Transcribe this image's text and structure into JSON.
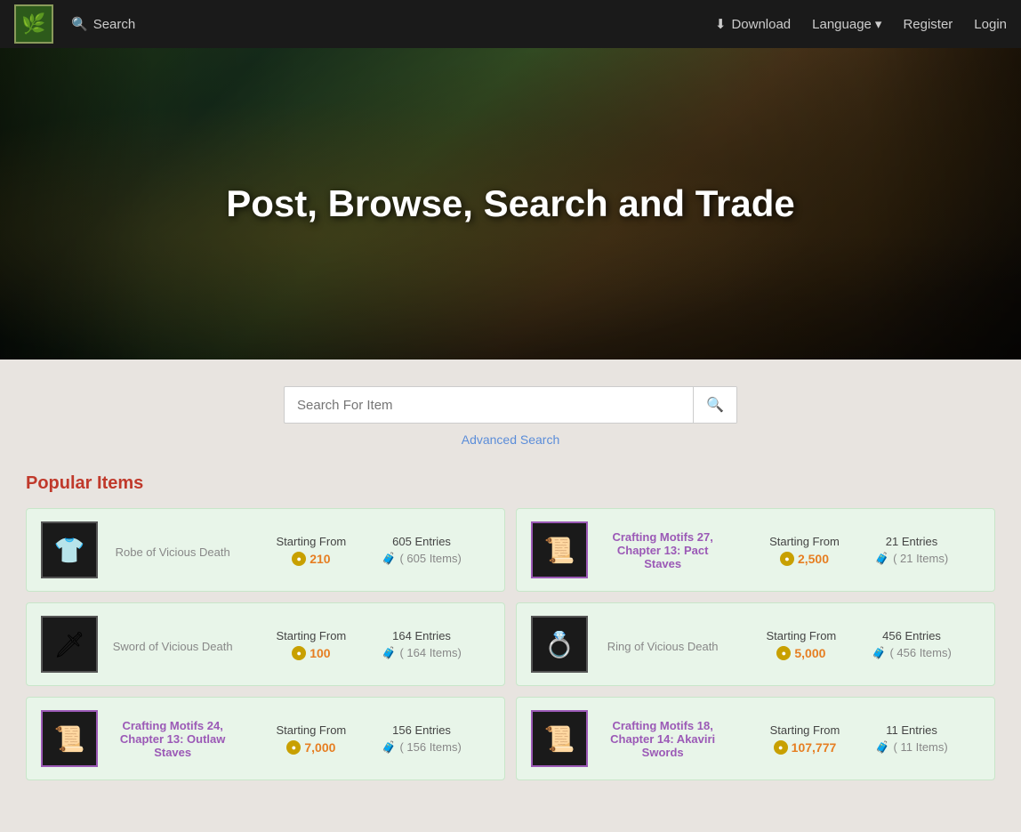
{
  "navbar": {
    "logo_icon": "🌿",
    "search_label": "Search",
    "download_label": "Download",
    "download_icon": "⬇",
    "language_label": "Language",
    "language_dropdown_icon": "▾",
    "register_label": "Register",
    "login_label": "Login"
  },
  "hero": {
    "title": "Post, Browse, Search and Trade"
  },
  "search": {
    "placeholder": "Search For Item",
    "advanced_link": "Advanced Search"
  },
  "popular": {
    "title": "Popular Items",
    "items": [
      {
        "id": 1,
        "name": "Robe of Vicious Death",
        "name_color": "gray",
        "starting_from_label": "Starting From",
        "price": "210",
        "price_color": "orange",
        "entries_count": "605 Entries",
        "items_count": "( 🧳 605 Items)",
        "thumb_icon": "👕",
        "thumb_style": "dark",
        "border_style": "normal"
      },
      {
        "id": 2,
        "name": "Crafting Motifs 27, Chapter 13: Pact Staves",
        "name_color": "purple",
        "starting_from_label": "Starting From",
        "price": "2,500",
        "price_color": "orange",
        "entries_count": "21 Entries",
        "items_count": "( 🧳 21 Items)",
        "thumb_icon": "📜",
        "thumb_style": "dark",
        "border_style": "purple"
      },
      {
        "id": 3,
        "name": "Sword of Vicious Death",
        "name_color": "gray",
        "starting_from_label": "Starting From",
        "price": "100",
        "price_color": "orange",
        "entries_count": "164 Entries",
        "items_count": "( 🧳 164 Items)",
        "thumb_icon": "🗡",
        "thumb_style": "dark",
        "border_style": "normal"
      },
      {
        "id": 4,
        "name": "Ring of Vicious Death",
        "name_color": "gray",
        "starting_from_label": "Starting From",
        "price": "5,000",
        "price_color": "orange",
        "entries_count": "456 Entries",
        "items_count": "( 🧳 456 Items)",
        "thumb_icon": "💍",
        "thumb_style": "dark",
        "border_style": "normal"
      },
      {
        "id": 5,
        "name": "Crafting Motifs 24, Chapter 13: Outlaw Staves",
        "name_color": "purple",
        "starting_from_label": "Starting From",
        "price": "7,000",
        "price_color": "orange",
        "entries_count": "156 Entries",
        "items_count": "( 🧳 156 Items)",
        "thumb_icon": "📜",
        "thumb_style": "dark",
        "border_style": "purple"
      },
      {
        "id": 6,
        "name": "Crafting Motifs 18, Chapter 14: Akaviri Swords",
        "name_color": "purple",
        "starting_from_label": "Starting From",
        "price": "107,777",
        "price_color": "orange",
        "entries_count": "11 Entries",
        "items_count": "( 🧳 11 Items)",
        "thumb_icon": "📜",
        "thumb_style": "dark",
        "border_style": "purple"
      }
    ]
  }
}
